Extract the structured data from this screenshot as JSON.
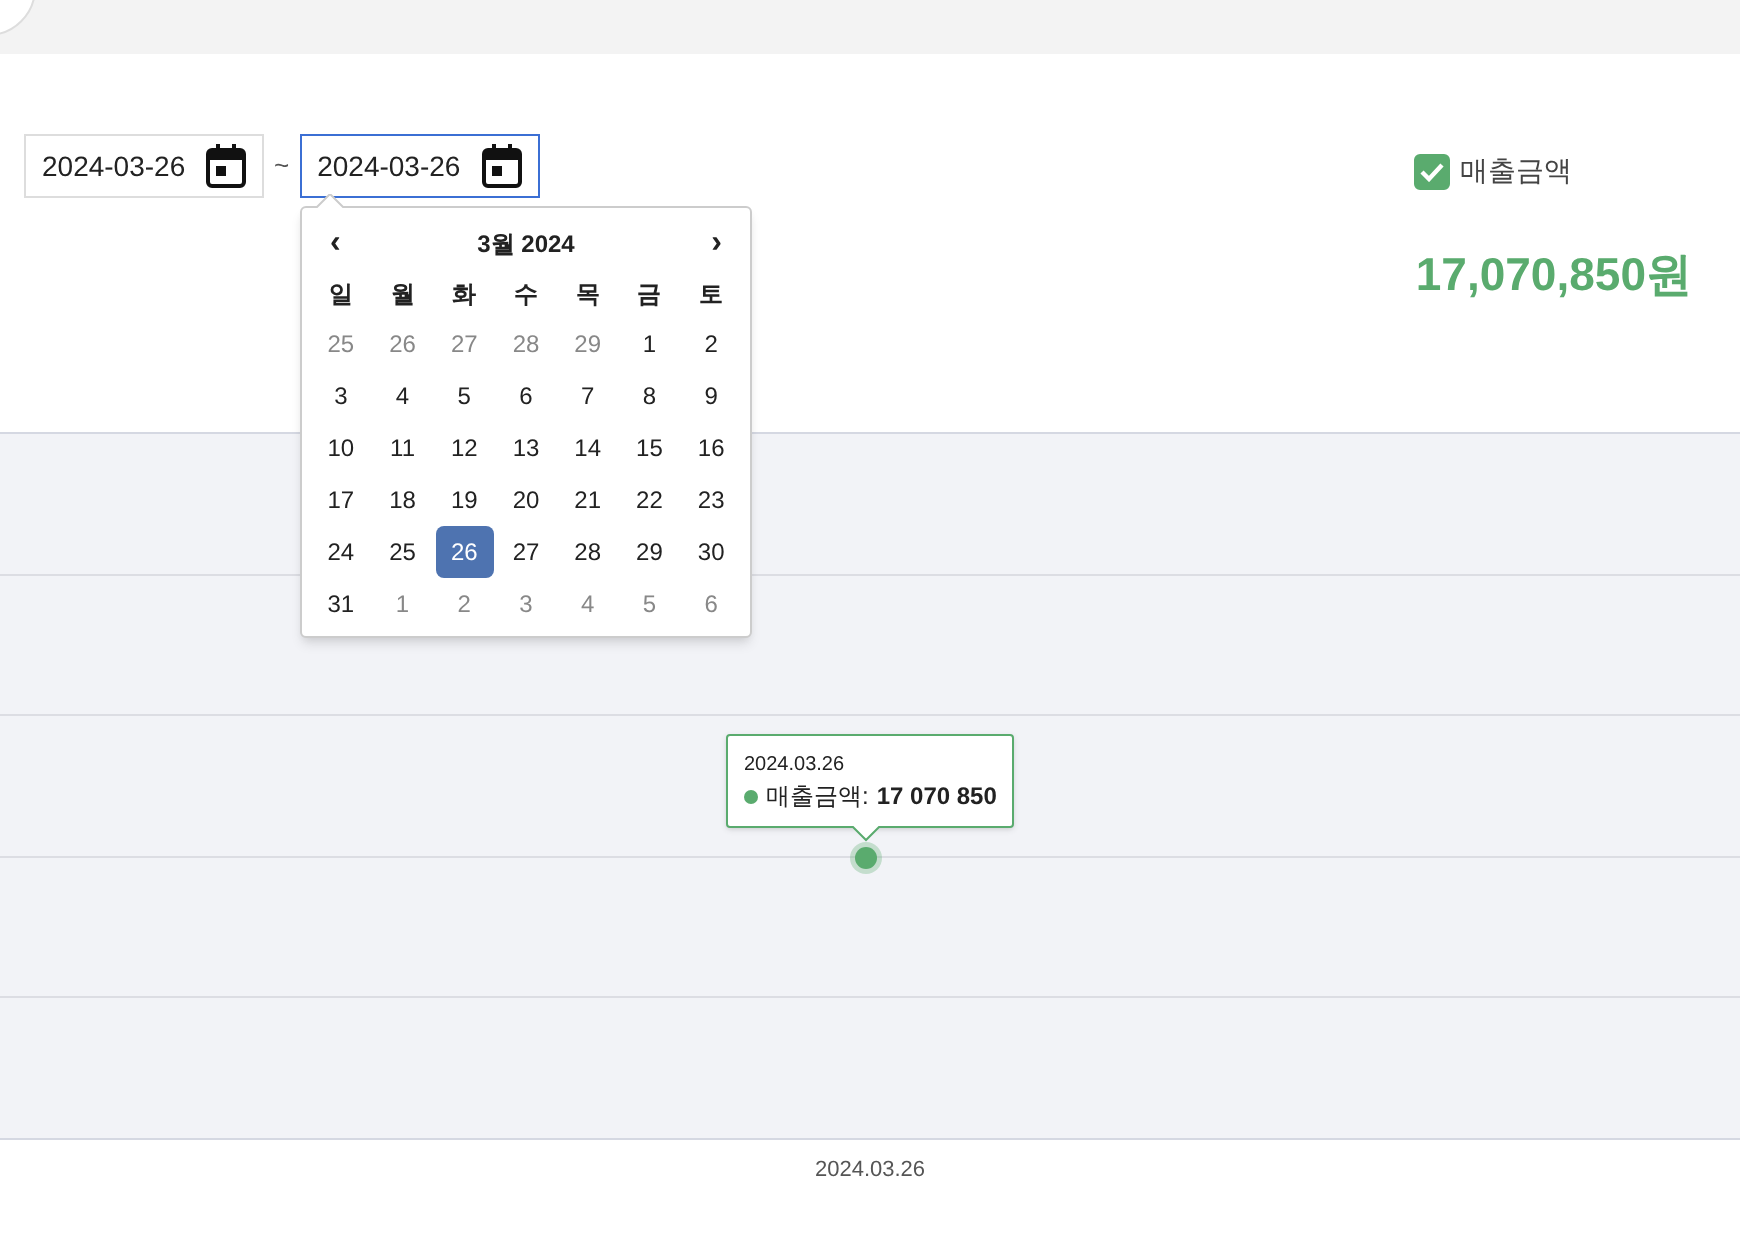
{
  "date_range": {
    "start": "2024-03-26",
    "separator": "~",
    "end": "2024-03-26",
    "end_focused": true
  },
  "calendar": {
    "prev": "‹",
    "title": "3월 2024",
    "next": "›",
    "weekdays": [
      "일",
      "월",
      "화",
      "수",
      "목",
      "금",
      "토"
    ],
    "weeks": [
      [
        {
          "day": "25",
          "outside": true,
          "selected": false
        },
        {
          "day": "26",
          "outside": true,
          "selected": false
        },
        {
          "day": "27",
          "outside": true,
          "selected": false
        },
        {
          "day": "28",
          "outside": true,
          "selected": false
        },
        {
          "day": "29",
          "outside": true,
          "selected": false
        },
        {
          "day": "1",
          "outside": false,
          "selected": false
        },
        {
          "day": "2",
          "outside": false,
          "selected": false
        }
      ],
      [
        {
          "day": "3",
          "outside": false,
          "selected": false
        },
        {
          "day": "4",
          "outside": false,
          "selected": false
        },
        {
          "day": "5",
          "outside": false,
          "selected": false
        },
        {
          "day": "6",
          "outside": false,
          "selected": false
        },
        {
          "day": "7",
          "outside": false,
          "selected": false
        },
        {
          "day": "8",
          "outside": false,
          "selected": false
        },
        {
          "day": "9",
          "outside": false,
          "selected": false
        }
      ],
      [
        {
          "day": "10",
          "outside": false,
          "selected": false
        },
        {
          "day": "11",
          "outside": false,
          "selected": false
        },
        {
          "day": "12",
          "outside": false,
          "selected": false
        },
        {
          "day": "13",
          "outside": false,
          "selected": false
        },
        {
          "day": "14",
          "outside": false,
          "selected": false
        },
        {
          "day": "15",
          "outside": false,
          "selected": false
        },
        {
          "day": "16",
          "outside": false,
          "selected": false
        }
      ],
      [
        {
          "day": "17",
          "outside": false,
          "selected": false
        },
        {
          "day": "18",
          "outside": false,
          "selected": false
        },
        {
          "day": "19",
          "outside": false,
          "selected": false
        },
        {
          "day": "20",
          "outside": false,
          "selected": false
        },
        {
          "day": "21",
          "outside": false,
          "selected": false
        },
        {
          "day": "22",
          "outside": false,
          "selected": false
        },
        {
          "day": "23",
          "outside": false,
          "selected": false
        }
      ],
      [
        {
          "day": "24",
          "outside": false,
          "selected": false
        },
        {
          "day": "25",
          "outside": false,
          "selected": false
        },
        {
          "day": "26",
          "outside": false,
          "selected": true
        },
        {
          "day": "27",
          "outside": false,
          "selected": false
        },
        {
          "day": "28",
          "outside": false,
          "selected": false
        },
        {
          "day": "29",
          "outside": false,
          "selected": false
        },
        {
          "day": "30",
          "outside": false,
          "selected": false
        }
      ],
      [
        {
          "day": "31",
          "outside": false,
          "selected": false
        },
        {
          "day": "1",
          "outside": true,
          "selected": false
        },
        {
          "day": "2",
          "outside": true,
          "selected": false
        },
        {
          "day": "3",
          "outside": true,
          "selected": false
        },
        {
          "day": "4",
          "outside": true,
          "selected": false
        },
        {
          "day": "5",
          "outside": true,
          "selected": false
        },
        {
          "day": "6",
          "outside": true,
          "selected": false
        }
      ]
    ]
  },
  "legend": {
    "label": "매출금액",
    "checked": true,
    "color": "#5aab6e"
  },
  "total": "17,070,850원",
  "chart": {
    "tooltip_date": "2024.03.26",
    "tooltip_label": "매출금액:",
    "tooltip_value": "17 070 850",
    "x_label": "2024.03.26"
  }
}
